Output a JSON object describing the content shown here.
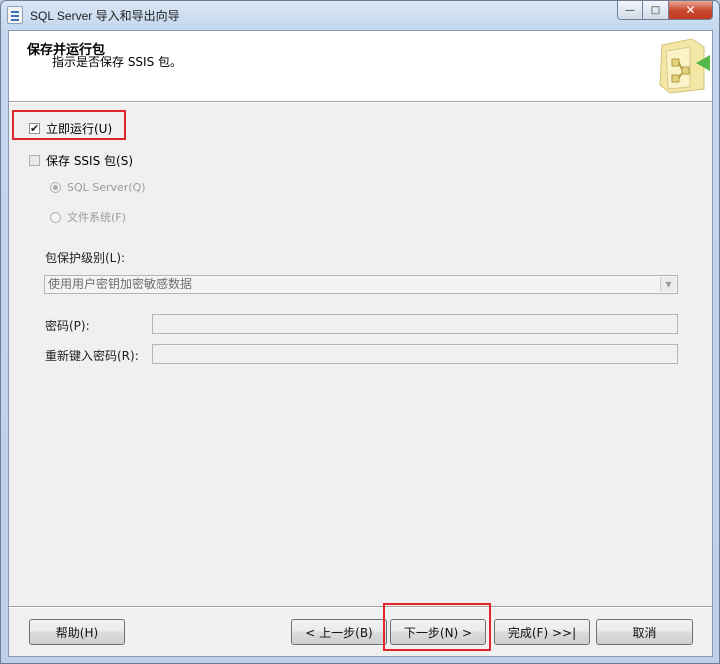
{
  "window": {
    "title": "SQL Server 导入和导出向导",
    "min_glyph": "—",
    "max_glyph": "□",
    "close_glyph": "✕"
  },
  "header": {
    "title": "保存并运行包",
    "subtitle": "指示是否保存 SSIS 包。"
  },
  "options": {
    "run_now": {
      "label": "立即运行(U)",
      "checked": true
    },
    "save_package": {
      "label": "保存 SSIS 包(S)",
      "checked": false
    },
    "sql_server": {
      "label": "SQL Server(Q)",
      "selected": true
    },
    "file_system": {
      "label": "文件系统(F)",
      "selected": false
    }
  },
  "protection": {
    "label": "包保护级别(L):",
    "value": "使用用户密钥加密敏感数据"
  },
  "password": {
    "label": "密码(P):",
    "value": ""
  },
  "retype_password": {
    "label": "重新键入密码(R):",
    "value": ""
  },
  "buttons": {
    "help": "帮助(H)",
    "back": "< 上一步(B)",
    "next": "下一步(N) >",
    "finish": "完成(F) >>|",
    "cancel": "取消"
  },
  "colors": {
    "highlight": "#e0262a",
    "disabled_text": "#9c9c9c"
  }
}
